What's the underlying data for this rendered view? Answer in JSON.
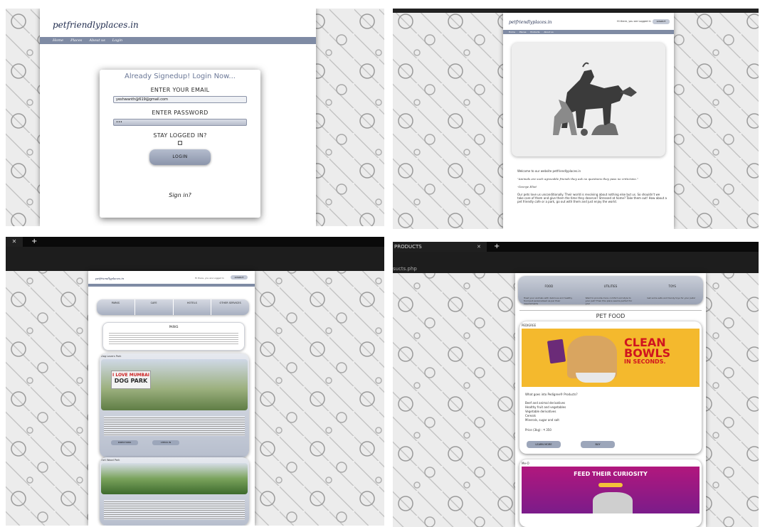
{
  "login_screen": {
    "logo": "petfriendlyplaces.in",
    "nav_items": [
      "Home",
      "Places",
      "About us",
      "Login"
    ],
    "heading": "Already Signedup! Login Now...",
    "email_label": "ENTER YOUR EMAIL",
    "email_value": "yeshwanth@619@gmail.com",
    "password_label": "ENTER PASSWORD",
    "password_value": "•••",
    "stay_label": "STAY LOGGED IN?",
    "login_button": "LOGIN",
    "signin_link": "Sign in?"
  },
  "home_screen": {
    "logo": "petfriendlyplaces.in",
    "welcome_user": "Hi there, you are Logged In",
    "logout_button": "LOGOUT",
    "nav_items": [
      "Home",
      "Places",
      "Products",
      "About us"
    ],
    "welcome_text": "Welcome to our website petfriendlyplaces.in",
    "quote": "\"Animals are such agreeable friends they ask no questions they pass no criticisms.\"",
    "quote_author": "-George Eliot",
    "body_text": "Our pets love us unconditionally. Their world is revolving about nothing else but us. So shouldn't we take care of them and give them the time they deserve? Stressed at home? Take them out! How about a pet friendly cafe or a park, go out with them and just enjoy the world."
  },
  "parks_screen": {
    "tab_icon": "close-icon",
    "logo": "petfriendlyplaces.in",
    "welcome_user": "Hi there, you are Logged In",
    "logout_button": "LOGOUT",
    "categories": [
      "PARKS",
      "CAFE",
      "HOTELS",
      "OTHER SERVICES"
    ],
    "section_title": "PARKS",
    "park1_title": "Dog Lovers Park",
    "park1_sign_top": "I LOVE MUMBAI",
    "park1_sign_bottom": "DOG PARK",
    "park2_title": "Fort Wood Park",
    "buttons": [
      "DIRECTIONS",
      "CHECK IN"
    ]
  },
  "products_screen": {
    "tab_label": "PRODUCTS",
    "url": "sucts.php",
    "categories": [
      {
        "name": "FOOD",
        "desc": "Treat your animals with delicious and healthy food just personalised as per their requirements"
      },
      {
        "name": "UTILITIES",
        "desc": "Want to provide more comfort and style to your pet? Then this place seems perfect for you!"
      },
      {
        "name": "TOYS",
        "desc": "Get some safe and trendy toys for your pets!"
      }
    ],
    "section_title": "PET FOOD",
    "product1_name": "PEDIGREE",
    "banner1_line1": "CLEAN",
    "banner1_line2": "BOWLS",
    "banner1_line3": "IN SECONDS.",
    "product1_question": "What goes into Pedigree® Products?",
    "product1_items": [
      "Beef and animal derivatives",
      "Healthy fruit and vegetables",
      "Vegetable derivatives",
      "Cereals",
      "Minerals, sugar and salt"
    ],
    "product1_price": "Price (3kg) : ₹ 350",
    "product_buttons": [
      "LEARN MORE",
      "BUY"
    ],
    "product2_name": "Me-O",
    "banner2_text": "FEED THEIR CURIOSITY"
  },
  "colors": {
    "accent": "#7f8ba4",
    "brand_text": "#1f2b4d",
    "pedigree_yellow": "#f4b92d",
    "meo_purple": "#b1177d"
  }
}
